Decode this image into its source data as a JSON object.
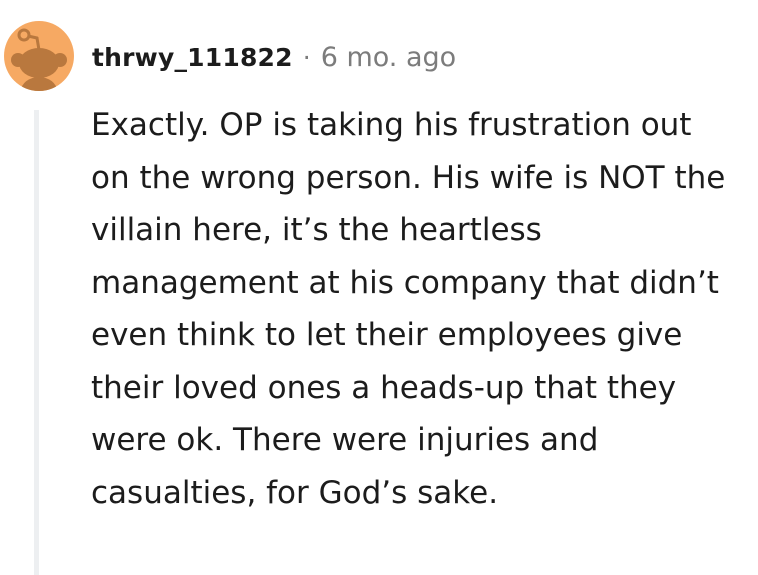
{
  "comment": {
    "avatar_icon": "reddit-snoo-avatar-icon",
    "username": "thrwy_111822",
    "separator": "·",
    "timestamp": "6 mo. ago",
    "body": "Exactly. OP is taking his frustration out on the wrong person. His wife is NOT the villain here, it’s the heartless management at his company that didn’t even think to let their employees give their loved ones a heads-up that they were ok. There were injuries and casualties, for God’s sake.",
    "colors": {
      "avatar_background": "#f6a963",
      "snoo": "#b9783e",
      "username": "#1c1c1c",
      "meta": "#7c7c7c",
      "thread_line": "#edeff1"
    }
  }
}
